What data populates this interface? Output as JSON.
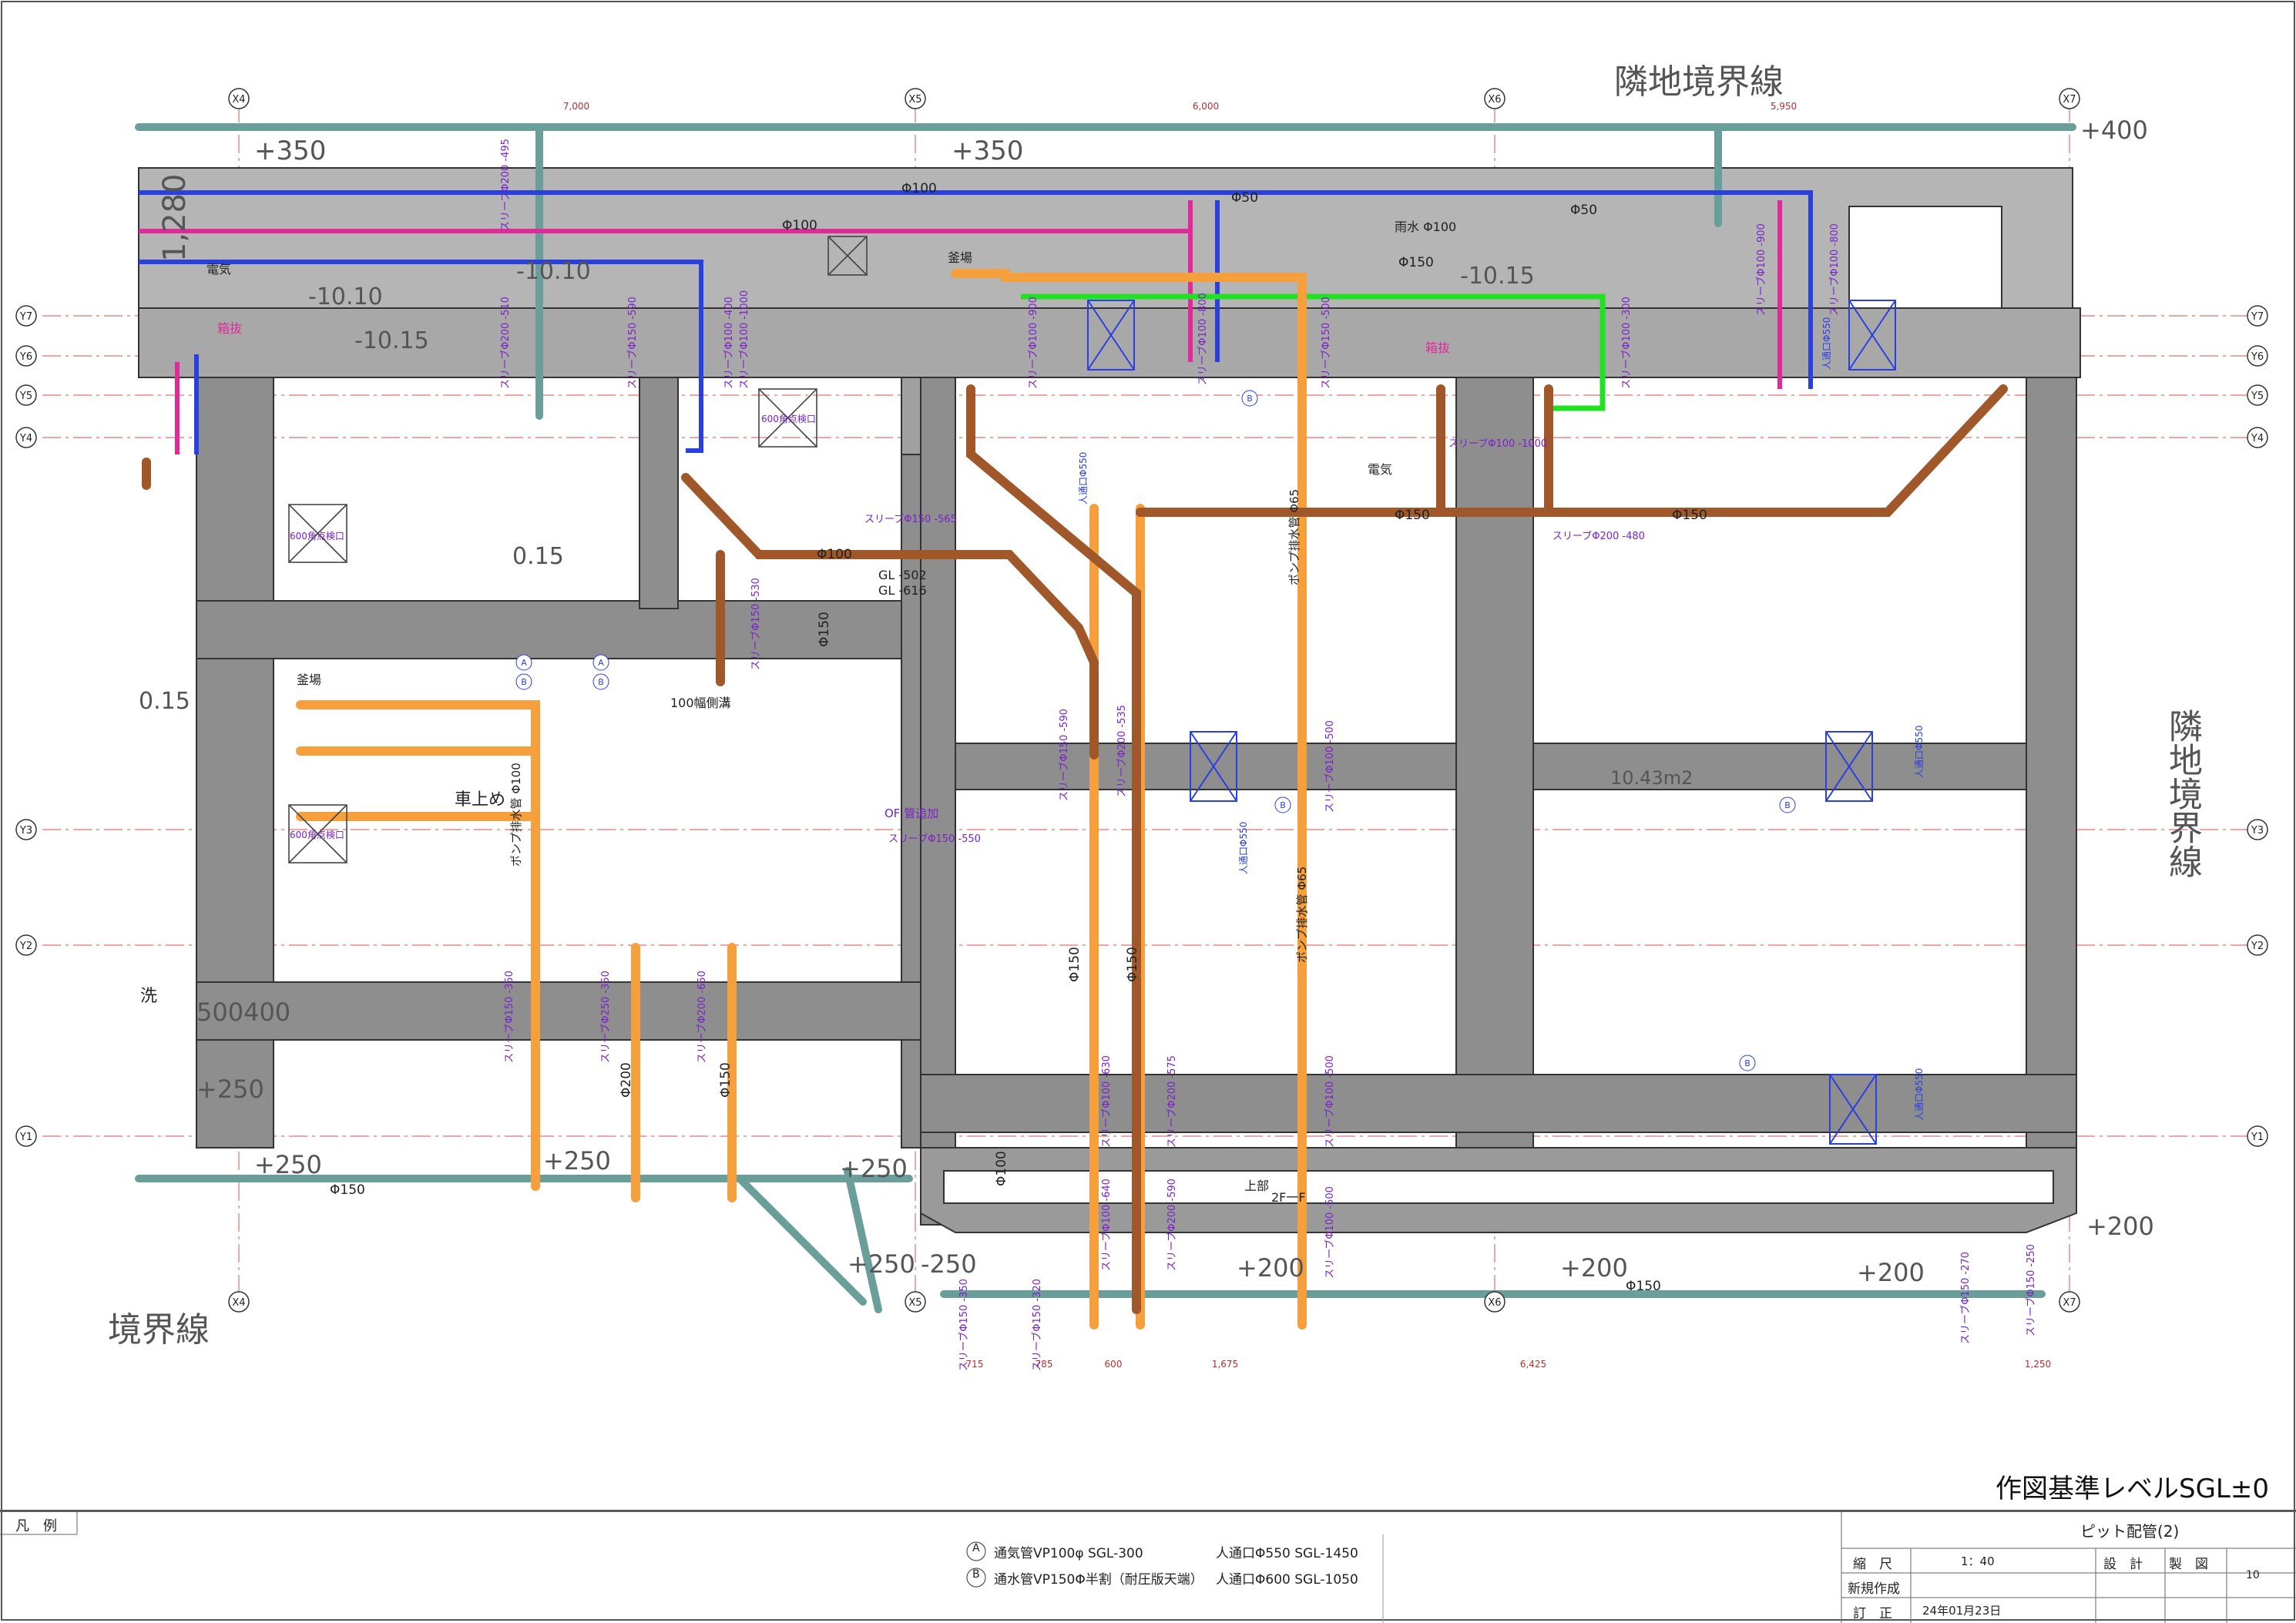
{
  "drawing": {
    "boundary_top": "隣地境界線",
    "boundary_right": "隣地境界線",
    "boundary_bottom_left": "境界線",
    "reference_level": "作図基準レベルSGL±0",
    "grid_top": [
      "X4",
      "X5",
      "X6",
      "X7"
    ],
    "grid_bottom": [
      "X4",
      "X5",
      "X6",
      "X7"
    ],
    "grid_rows": [
      "Y7",
      "Y6",
      "Y5",
      "Y4",
      "Y3",
      "Y2",
      "Y1"
    ],
    "dims_top": [
      "7,000",
      "6,000",
      "5,950"
    ],
    "dims_bottom": [
      "715",
      "785",
      "600",
      "1,675",
      "6,425",
      "1,250"
    ],
    "levels": [
      "+350",
      "+350",
      "+400",
      "+250",
      "+250",
      "+250",
      "+250",
      "+200",
      "+200",
      "+200",
      "+200",
      "+250",
      "-250",
      "500400",
      "-10.10",
      "-10.10",
      "-10.10",
      "-10.15",
      "-10.15",
      "-10.15",
      "0.15",
      "1,280"
    ],
    "rooms": [
      "釜場",
      "釜場",
      "車上め",
      "洗",
      "100幅側溝",
      "電気",
      "電気",
      "雨水 Φ100",
      "上部",
      "2F一F",
      "10.43m2",
      "箱抜",
      "箱抜"
    ],
    "hatches": [
      "600角点検口",
      "600角点検口",
      "600角点検口",
      "600角点検口"
    ],
    "pipes": [
      "Φ100",
      "Φ50",
      "Φ50",
      "Φ150",
      "Φ100",
      "Φ150",
      "Φ150",
      "Φ150",
      "Φ100",
      "Φ150",
      "Φ200",
      "Φ150",
      "Φ150",
      "Φ100",
      "Φ150",
      "Φ150"
    ],
    "pump_pipes": [
      "ポンプ排水管 Φ100",
      "ポンプ排水管 Φ65",
      "ポンプ排水管 Φ65"
    ],
    "sleeves_v": [
      "スリーブΦ200 -495",
      "スリーブΦ200 -510",
      "スリーブΦ150 -590",
      "スリーブΦ100 -400",
      "スリーブΦ100 -1000",
      "スリーブΦ100 -900",
      "スリーブΦ100 -800",
      "スリーブΦ150 -500",
      "スリーブΦ100 -300",
      "スリーブΦ100 -900",
      "スリーブΦ100 -800",
      "スリーブΦ150 -530",
      "スリーブΦ150 -590",
      "スリーブΦ200 -535",
      "スリーブΦ100 -500",
      "スリーブΦ150 -350",
      "スリーブΦ250 -350",
      "スリーブΦ200 -650",
      "スリーブΦ100 -630",
      "スリーブΦ200 -575",
      "スリーブΦ100 -500",
      "スリーブΦ100 -640",
      "スリーブΦ200 -590",
      "スリーブΦ100 -500",
      "スリーブΦ150 -350",
      "スリーブΦ150 -320",
      "スリーブΦ150 -270",
      "スリーブΦ150 -250"
    ],
    "sleeves_h": [
      "スリーブΦ150 -565",
      "スリーブΦ100 -1000",
      "スリーブΦ200 -480",
      "スリーブΦ150 -550"
    ],
    "manholes": [
      "人通口Φ550",
      "人通口Φ550",
      "人通口Φ550",
      "人通口Φ550",
      "人通口Φ550"
    ],
    "gl_notes": [
      "GL -502",
      "GL -616"
    ],
    "of_note": "OF 管追加",
    "circle_markers": [
      "A",
      "A",
      "B",
      "B",
      "B",
      "B",
      "B",
      "B"
    ]
  },
  "legend": {
    "title": "凡　例",
    "items": [
      {
        "marker": "A",
        "text": "通気管VP100φ  SGL-300"
      },
      {
        "marker": "B",
        "text": "通水管VP150Φ半割（耐圧版天端）"
      }
    ],
    "manhole_items": [
      "人通口Φ550  SGL-1450",
      "人通口Φ600  SGL-1050"
    ]
  },
  "title_block": {
    "sheet_name": "ピット配管(2)",
    "scale_label": "縮　尺",
    "scale_value": "1：40",
    "new_label": "新規作成",
    "revision_label": "訂　正",
    "revision_date": "24年01月23日",
    "design_label": "設　計",
    "drawing_label": "製　図",
    "page_number": "10"
  },
  "colors": {
    "wall": "#8c8c8c",
    "orange_pipe": "#f5a03c",
    "brown_pipe": "#a0582a",
    "teal_pipe": "#6a9e9a",
    "blue_pipe": "#2a3fe0",
    "pink_pipe": "#e02a9a",
    "green_pipe": "#22e022",
    "sleeve_text": "#7a22c8"
  }
}
